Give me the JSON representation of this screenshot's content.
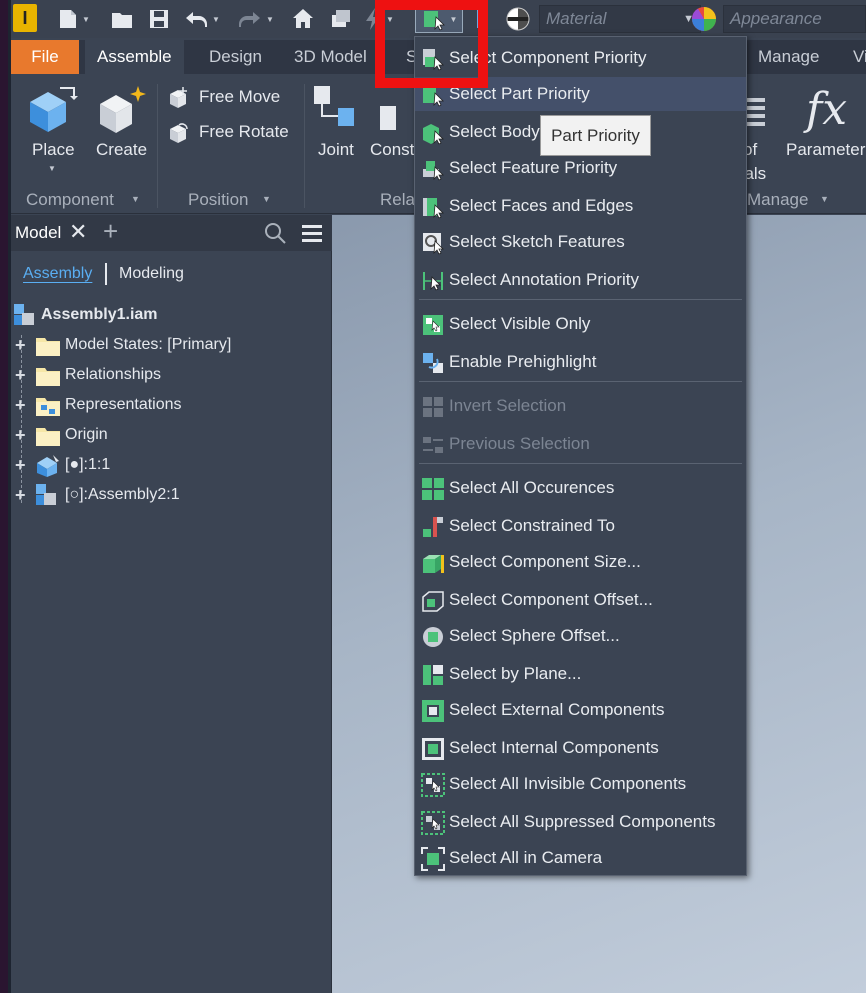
{
  "qat": {
    "material_placeholder": "Material",
    "appearance_placeholder": "Appearance"
  },
  "tabs": [
    "File",
    "Assemble",
    "Design",
    "3D Model",
    "S",
    "Manage",
    "Vi"
  ],
  "ribbon": {
    "place": "Place",
    "create": "Create",
    "free_move": "Free Move",
    "free_rotate": "Free Rotate",
    "joint": "Joint",
    "constrain": "Const",
    "bom_top": "of",
    "bom_bottom": "rials",
    "parameters": "Parameter",
    "groups": {
      "component": "Component",
      "position": "Position",
      "relationships": "Rela",
      "manage": "Manage"
    }
  },
  "browser": {
    "title": "Model",
    "subtabs": [
      "Assembly",
      "Modeling"
    ],
    "root": "Assembly1.iam",
    "items": [
      "Model States: [Primary]",
      "Relationships",
      "Representations",
      "Origin",
      "[●]:1:1",
      "[○]:Assembly2:1"
    ]
  },
  "menu": {
    "items": [
      "Select Component Priority",
      "Select Part Priority",
      "Select Body",
      "Select Feature Priority",
      "Select Faces and Edges",
      "Select Sketch Features",
      "Select Annotation Priority",
      "Select Visible Only",
      "Enable Prehighlight",
      "Invert Selection",
      "Previous Selection",
      "Select All Occurences",
      "Select Constrained To",
      "Select Component Size...",
      "Select Component Offset...",
      "Select Sphere Offset...",
      "Select by Plane...",
      "Select External Components",
      "Select Internal Components",
      "Select All Invisible Components",
      "Select All Suppressed Components",
      "Select All in Camera"
    ]
  },
  "tooltip": "Part Priority",
  "colors": {
    "accent_green": "#4cc27a",
    "file_tab": "#e8792d",
    "highlight": "#ee1111"
  }
}
